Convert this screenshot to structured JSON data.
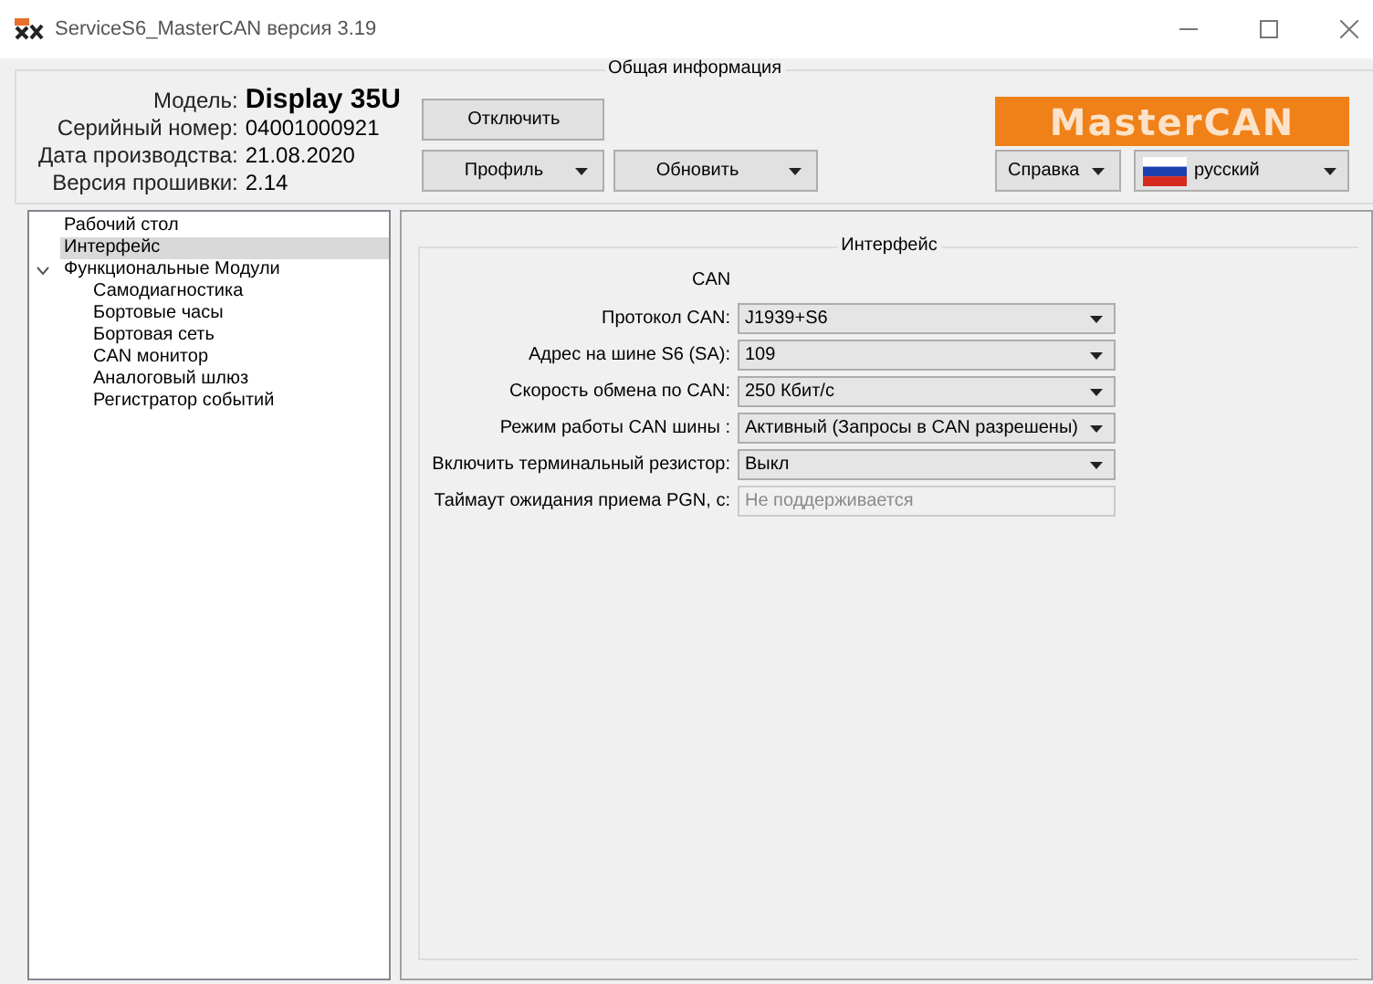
{
  "window": {
    "title": "ServiceS6_MasterCAN версия 3.19"
  },
  "info": {
    "title": "Общая информация",
    "rows": [
      {
        "label": "Модель:",
        "value": "Display 35U",
        "kind": "model"
      },
      {
        "label": "Серийный номер:",
        "value": "04001000921",
        "kind": "plain"
      },
      {
        "label": "Дата производства:",
        "value": "21.08.2020",
        "kind": "plain"
      },
      {
        "label": "Версия прошивки:",
        "value": "2.14",
        "kind": "plain"
      }
    ],
    "buttons": [
      {
        "label": "Отключить",
        "kind": "plain"
      },
      {
        "label": "Профиль",
        "kind": "menu"
      },
      {
        "label": "Обновить",
        "kind": "menu"
      }
    ],
    "logo": "MasterCAN",
    "help": {
      "label": "Справка"
    },
    "language": {
      "value": "русский"
    }
  },
  "tree": [
    {
      "label": "Рабочий стол",
      "selected": false
    },
    {
      "label": "Интерфейс",
      "selected": true
    },
    {
      "label": "Функциональные Модули",
      "selected": false,
      "expanded": true,
      "children": [
        {
          "label": "Самодиагностика",
          "selected": false
        },
        {
          "label": "Бортовые часы",
          "selected": false
        },
        {
          "label": "Бортовая сеть",
          "selected": false
        },
        {
          "label": "CAN монитор",
          "selected": false
        },
        {
          "label": "Аналоговый шлюз",
          "selected": false
        },
        {
          "label": "Регистратор событий",
          "selected": false
        }
      ]
    }
  ],
  "panel": {
    "title": "Интерфейс",
    "section": "CAN",
    "fields": [
      {
        "label": "Протокол CAN:",
        "kind": "select",
        "value": "J1939+S6",
        "disabled": false
      },
      {
        "label": "Адрес на шине S6 (SA):",
        "kind": "select",
        "value": "109",
        "disabled": false
      },
      {
        "label": "Скорость обмена по CAN:",
        "kind": "select",
        "value": "250 Кбит/с",
        "disabled": false
      },
      {
        "label": "Режим работы CAN шины :",
        "kind": "select",
        "value": "Активный (Запросы в CAN разрешены)",
        "disabled": false
      },
      {
        "label": "Включить терминальный резистор:",
        "kind": "select",
        "value": "Выкл",
        "disabled": false
      },
      {
        "label": "Таймаут ожидания приема PGN, с:",
        "kind": "text",
        "value": "Не поддерживается",
        "disabled": true
      }
    ]
  }
}
